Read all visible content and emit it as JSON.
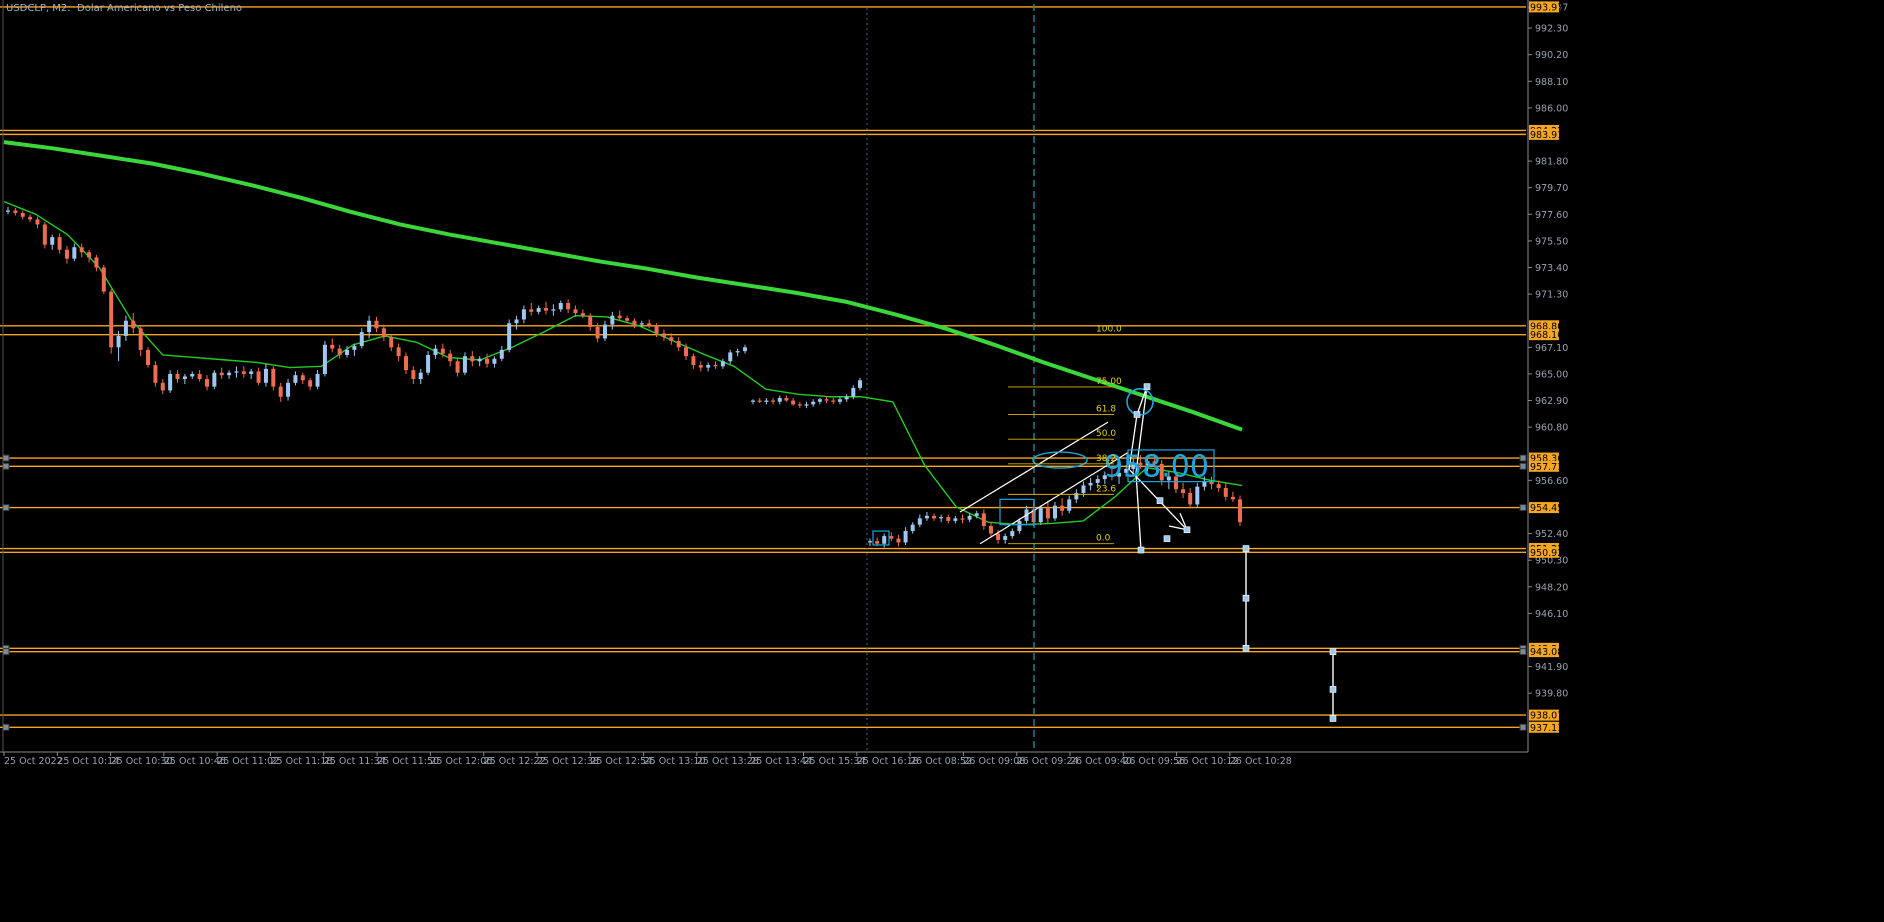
{
  "header": {
    "symbol_text": "USDCLP, M2:  Dolar Americano vs Peso Chileno"
  },
  "colors": {
    "background": "#000000",
    "bull_candle": "#9ec8f0",
    "bear_candle": "#f06c50",
    "level_line": "#f5a623",
    "ma_fast": "#22cc22",
    "ma_slow": "#3ad63a",
    "drawing": "#ffffff",
    "cyan_object": "#1aa6e0",
    "fib_text": "#e6d21a",
    "axis_text": "#9aa0b0",
    "separator": "#2a4a5a"
  },
  "chart_data": {
    "type": "candlestick",
    "symbol": "USDCLP",
    "timeframe": "M2",
    "ylim": [
      936.5,
      994.2
    ],
    "y_ticks": [
      "993.97",
      "992.30",
      "990.20",
      "988.10",
      "986.00",
      "981.80",
      "979.70",
      "977.60",
      "975.50",
      "973.40",
      "971.30",
      "967.10",
      "965.00",
      "962.90",
      "960.80",
      "956.60",
      "952.40",
      "950.30",
      "948.20",
      "946.10",
      "941.90",
      "939.80"
    ],
    "x_ticks": [
      "25 Oct 2022",
      "25 Oct 10:14",
      "25 Oct 10:30",
      "25 Oct 10:46",
      "25 Oct 11:02",
      "25 Oct 11:18",
      "25 Oct 11:34",
      "25 Oct 11:50",
      "25 Oct 12:06",
      "25 Oct 12:22",
      "25 Oct 12:38",
      "25 Oct 12:54",
      "25 Oct 13:10",
      "25 Oct 13:28",
      "25 Oct 13:44",
      "25 Oct 15:34",
      "25 Oct 16:18",
      "26 Oct 08:52",
      "26 Oct 09:08",
      "26 Oct 09:24",
      "26 Oct 09:40",
      "26 Oct 09:56",
      "26 Oct 10:12",
      "26 Oct 10:28"
    ],
    "horizontal_levels": [
      {
        "price": 993.97,
        "label": "993.97"
      },
      {
        "price": 984.22,
        "label": "984.22"
      },
      {
        "price": 983.91,
        "label": "983.91"
      },
      {
        "price": 968.8,
        "label": "968.80"
      },
      {
        "price": 968.1,
        "label": "968.10"
      },
      {
        "price": 958.36,
        "label": "958.36"
      },
      {
        "price": 957.71,
        "label": "957.71"
      },
      {
        "price": 954.45,
        "label": "954.45"
      },
      {
        "price": 951.22,
        "label": "951.22"
      },
      {
        "price": 950.92,
        "label": "950.92"
      },
      {
        "price": 943.34,
        "label": "943.34"
      },
      {
        "price": 943.08,
        "label": "943.08"
      },
      {
        "price": 938.07,
        "label": "938.07"
      },
      {
        "price": 937.11,
        "label": "937.11"
      }
    ],
    "fibonacci": {
      "levels": [
        "100.0",
        "75.00",
        "61.8",
        "50.0",
        "38.2",
        "23.6",
        "0.0"
      ],
      "price_high": 968.1,
      "price_low": 951.6
    },
    "big_price_text": "958.00",
    "ma_slow": [
      983.3,
      982.8,
      982.2,
      981.6,
      980.8,
      979.9,
      978.9,
      977.8,
      976.8,
      976.0,
      975.3,
      974.6,
      973.9,
      973.3,
      972.6,
      972.0,
      971.4,
      970.7,
      969.7,
      968.6,
      967.3,
      965.9,
      964.6,
      963.3,
      962.0,
      960.6
    ],
    "ma_fast": [
      978.6,
      977.6,
      976.0,
      973.4,
      969.3,
      966.5,
      966.3,
      966.1,
      965.9,
      965.5,
      965.6,
      967.3,
      968.0,
      967.5,
      966.3,
      966.1,
      967.1,
      968.3,
      969.6,
      969.5,
      968.8,
      967.7,
      966.6,
      965.6,
      963.8,
      963.4,
      963.2,
      963.2,
      962.8,
      957.8,
      954.5,
      953.3,
      953.1,
      953.2,
      953.4,
      955.3,
      957.6,
      957.2,
      956.6,
      956.2
    ],
    "candles": [
      [
        977.8,
        978.2,
        977.6,
        977.9
      ],
      [
        977.9,
        978.1,
        977.5,
        977.7
      ],
      [
        977.7,
        977.9,
        977.2,
        977.4
      ],
      [
        977.4,
        977.6,
        977.0,
        977.2
      ],
      [
        977.2,
        977.4,
        976.5,
        976.8
      ],
      [
        976.8,
        977.0,
        974.9,
        975.2
      ],
      [
        975.2,
        976.0,
        974.8,
        975.8
      ],
      [
        975.8,
        976.1,
        974.5,
        974.8
      ],
      [
        974.8,
        975.1,
        973.7,
        974.1
      ],
      [
        974.1,
        975.3,
        973.9,
        975.0
      ],
      [
        975.0,
        975.3,
        974.2,
        974.6
      ],
      [
        974.6,
        974.8,
        973.8,
        974.2
      ],
      [
        974.2,
        974.4,
        973.1,
        973.4
      ],
      [
        973.4,
        973.6,
        971.3,
        971.5
      ],
      [
        971.5,
        971.7,
        966.6,
        967.1
      ],
      [
        967.1,
        968.4,
        966.0,
        968.0
      ],
      [
        968.0,
        969.6,
        967.6,
        969.2
      ],
      [
        969.2,
        969.8,
        968.2,
        968.6
      ],
      [
        968.6,
        968.8,
        966.4,
        966.9
      ],
      [
        966.9,
        967.1,
        965.5,
        965.7
      ],
      [
        965.7,
        966.0,
        964.0,
        964.3
      ],
      [
        964.3,
        964.6,
        963.4,
        963.7
      ],
      [
        963.7,
        965.3,
        963.5,
        965.0
      ],
      [
        965.0,
        965.3,
        964.3,
        964.6
      ],
      [
        964.6,
        965.0,
        964.2,
        964.8
      ],
      [
        964.8,
        965.2,
        964.6,
        965.0
      ],
      [
        965.0,
        965.3,
        964.4,
        964.6
      ],
      [
        964.6,
        964.9,
        963.7,
        964.0
      ],
      [
        964.0,
        965.3,
        963.8,
        965.1
      ],
      [
        965.1,
        965.5,
        964.6,
        964.9
      ],
      [
        964.9,
        965.3,
        964.6,
        965.1
      ],
      [
        965.1,
        965.6,
        964.7,
        965.2
      ],
      [
        965.2,
        965.6,
        964.7,
        965.0
      ],
      [
        965.0,
        965.4,
        964.6,
        965.2
      ],
      [
        965.2,
        965.5,
        964.1,
        964.3
      ],
      [
        964.3,
        965.8,
        964.0,
        965.4
      ],
      [
        965.4,
        965.6,
        963.7,
        964.0
      ],
      [
        964.0,
        964.3,
        962.8,
        963.2
      ],
      [
        963.2,
        964.6,
        962.9,
        964.3
      ],
      [
        964.3,
        965.2,
        964.1,
        964.9
      ],
      [
        964.9,
        965.1,
        964.2,
        964.5
      ],
      [
        964.5,
        964.7,
        963.7,
        964.0
      ],
      [
        964.0,
        965.3,
        963.8,
        965.0
      ],
      [
        965.0,
        967.6,
        964.8,
        967.3
      ],
      [
        967.3,
        967.8,
        966.7,
        967.0
      ],
      [
        967.0,
        967.3,
        966.2,
        966.5
      ],
      [
        966.5,
        967.2,
        966.3,
        966.9
      ],
      [
        966.9,
        967.4,
        966.4,
        967.2
      ],
      [
        967.2,
        968.6,
        967.0,
        968.3
      ],
      [
        968.3,
        969.6,
        967.8,
        969.2
      ],
      [
        969.2,
        969.5,
        968.3,
        968.6
      ],
      [
        968.6,
        968.9,
        967.6,
        967.9
      ],
      [
        967.9,
        968.1,
        966.8,
        967.1
      ],
      [
        967.1,
        967.4,
        966.0,
        966.4
      ],
      [
        966.4,
        966.7,
        965.0,
        965.3
      ],
      [
        965.3,
        965.6,
        964.2,
        964.6
      ],
      [
        964.6,
        965.4,
        964.2,
        965.1
      ],
      [
        965.1,
        966.8,
        964.9,
        966.5
      ],
      [
        966.5,
        967.3,
        966.2,
        967.0
      ],
      [
        967.0,
        967.4,
        966.3,
        966.6
      ],
      [
        966.6,
        966.9,
        965.6,
        966.0
      ],
      [
        966.0,
        966.3,
        964.8,
        965.1
      ],
      [
        965.1,
        966.7,
        964.9,
        966.4
      ],
      [
        966.4,
        966.8,
        965.6,
        966.0
      ],
      [
        966.0,
        966.4,
        965.6,
        966.2
      ],
      [
        966.2,
        966.6,
        965.5,
        965.8
      ],
      [
        965.8,
        966.4,
        965.5,
        966.2
      ],
      [
        966.2,
        967.2,
        966.0,
        966.9
      ],
      [
        966.9,
        969.3,
        966.7,
        969.0
      ],
      [
        969.0,
        969.6,
        968.5,
        969.3
      ],
      [
        969.3,
        970.4,
        969.0,
        970.1
      ],
      [
        970.1,
        970.6,
        969.6,
        969.9
      ],
      [
        969.9,
        970.4,
        969.7,
        970.2
      ],
      [
        970.2,
        970.7,
        969.7,
        970.0
      ],
      [
        970.0,
        970.5,
        969.6,
        970.1
      ],
      [
        970.1,
        970.8,
        969.9,
        970.6
      ],
      [
        970.6,
        970.9,
        969.8,
        970.1
      ],
      [
        970.1,
        970.4,
        969.5,
        969.8
      ],
      [
        969.8,
        970.1,
        969.4,
        969.6
      ],
      [
        969.6,
        969.8,
        968.4,
        968.7
      ],
      [
        968.7,
        969.0,
        967.5,
        967.8
      ],
      [
        967.8,
        969.2,
        967.6,
        968.9
      ],
      [
        968.9,
        969.9,
        968.5,
        969.6
      ],
      [
        969.6,
        970.0,
        969.2,
        969.4
      ],
      [
        969.4,
        969.6,
        969.0,
        969.2
      ],
      [
        969.2,
        969.4,
        968.6,
        968.9
      ],
      [
        968.9,
        969.2,
        968.7,
        969.0
      ],
      [
        969.0,
        969.3,
        968.6,
        968.8
      ],
      [
        968.8,
        969.0,
        967.9,
        968.2
      ],
      [
        968.2,
        968.5,
        967.6,
        967.9
      ],
      [
        967.9,
        968.2,
        967.3,
        967.6
      ],
      [
        967.6,
        967.9,
        966.8,
        967.1
      ],
      [
        967.1,
        967.4,
        966.1,
        966.4
      ],
      [
        966.4,
        966.6,
        965.4,
        965.7
      ],
      [
        965.7,
        966.0,
        965.2,
        965.5
      ],
      [
        965.5,
        965.9,
        965.2,
        965.7
      ],
      [
        965.7,
        966.0,
        965.4,
        965.6
      ],
      [
        965.6,
        966.2,
        965.4,
        966.0
      ],
      [
        966.0,
        966.9,
        965.8,
        966.7
      ],
      [
        966.7,
        967.0,
        966.4,
        966.8
      ],
      [
        966.8,
        967.3,
        966.6,
        967.1
      ],
      [
        962.8,
        963.0,
        962.6,
        962.9
      ],
      [
        962.9,
        963.1,
        962.7,
        962.8
      ],
      [
        962.8,
        963.1,
        962.6,
        962.9
      ],
      [
        962.9,
        963.1,
        962.6,
        962.8
      ],
      [
        962.8,
        963.3,
        962.6,
        963.1
      ],
      [
        963.1,
        963.3,
        962.8,
        962.9
      ],
      [
        962.9,
        963.1,
        962.5,
        962.6
      ],
      [
        962.6,
        962.8,
        962.3,
        962.5
      ],
      [
        962.5,
        962.8,
        962.3,
        962.6
      ],
      [
        962.6,
        963.0,
        962.4,
        962.8
      ],
      [
        962.8,
        963.1,
        962.6,
        963.0
      ],
      [
        963.0,
        963.2,
        962.7,
        962.9
      ],
      [
        962.9,
        963.1,
        962.6,
        962.8
      ],
      [
        962.8,
        963.2,
        962.6,
        963.0
      ],
      [
        963.0,
        963.4,
        962.8,
        963.2
      ],
      [
        963.2,
        964.1,
        963.0,
        963.9
      ],
      [
        963.9,
        964.7,
        963.7,
        964.5
      ],
      [
        951.7,
        952.0,
        951.4,
        951.8
      ],
      [
        951.8,
        952.1,
        951.4,
        951.6
      ],
      [
        951.6,
        952.4,
        951.3,
        952.2
      ],
      [
        952.2,
        952.5,
        951.8,
        952.0
      ],
      [
        952.0,
        952.3,
        951.4,
        951.7
      ],
      [
        951.7,
        952.9,
        951.5,
        952.6
      ],
      [
        952.6,
        953.3,
        952.4,
        953.1
      ],
      [
        953.1,
        953.9,
        952.9,
        953.6
      ],
      [
        953.6,
        954.1,
        953.4,
        953.8
      ],
      [
        953.8,
        954.0,
        953.4,
        953.6
      ],
      [
        953.6,
        953.9,
        953.3,
        953.7
      ],
      [
        953.7,
        953.9,
        953.2,
        953.4
      ],
      [
        953.4,
        953.8,
        953.2,
        953.6
      ],
      [
        953.6,
        953.9,
        953.2,
        953.5
      ],
      [
        953.5,
        954.0,
        953.3,
        953.8
      ],
      [
        953.8,
        954.2,
        953.6,
        954.0
      ],
      [
        954.0,
        954.3,
        952.7,
        953.0
      ],
      [
        953.0,
        953.3,
        952.1,
        952.4
      ],
      [
        952.4,
        952.7,
        951.6,
        951.9
      ],
      [
        951.9,
        952.4,
        951.6,
        952.2
      ],
      [
        952.2,
        952.8,
        952.0,
        952.6
      ],
      [
        952.6,
        953.6,
        952.4,
        953.4
      ],
      [
        953.4,
        954.6,
        953.2,
        954.3
      ],
      [
        954.3,
        954.9,
        953.0,
        953.3
      ],
      [
        953.3,
        954.6,
        953.1,
        954.4
      ],
      [
        954.4,
        955.0,
        953.2,
        953.6
      ],
      [
        953.6,
        954.9,
        953.4,
        954.6
      ],
      [
        954.6,
        955.2,
        953.8,
        954.2
      ],
      [
        954.2,
        955.4,
        954.0,
        955.1
      ],
      [
        955.1,
        955.9,
        954.8,
        955.6
      ],
      [
        955.6,
        956.5,
        955.3,
        956.2
      ],
      [
        956.2,
        956.8,
        955.8,
        956.4
      ],
      [
        956.4,
        957.0,
        956.0,
        956.7
      ],
      [
        956.7,
        957.3,
        956.3,
        957.0
      ],
      [
        957.0,
        957.6,
        956.6,
        956.9
      ],
      [
        956.9,
        957.4,
        956.3,
        957.2
      ],
      [
        957.2,
        957.8,
        956.9,
        957.5
      ],
      [
        957.5,
        958.3,
        957.2,
        958.0
      ],
      [
        958.0,
        958.6,
        957.5,
        957.8
      ],
      [
        957.8,
        958.3,
        957.3,
        958.1
      ],
      [
        958.1,
        958.7,
        957.6,
        957.9
      ],
      [
        957.9,
        958.2,
        956.2,
        956.6
      ],
      [
        956.6,
        957.3,
        955.9,
        956.9
      ],
      [
        956.9,
        957.2,
        955.6,
        955.9
      ],
      [
        955.9,
        956.4,
        955.2,
        955.6
      ],
      [
        955.6,
        956.0,
        954.4,
        954.7
      ],
      [
        954.7,
        956.4,
        954.5,
        956.1
      ],
      [
        956.1,
        956.9,
        955.8,
        956.5
      ],
      [
        956.5,
        956.9,
        955.9,
        956.3
      ],
      [
        956.3,
        956.6,
        955.7,
        956.0
      ],
      [
        956.0,
        956.4,
        955.0,
        955.3
      ],
      [
        955.3,
        955.7,
        954.9,
        955.1
      ],
      [
        955.1,
        955.4,
        953.0,
        953.3
      ]
    ],
    "projection_points": [
      {
        "price": 951.22
      },
      {
        "price": 947.3
      },
      {
        "price": 943.34
      },
      {
        "price": 943.08
      },
      {
        "price": 940.1
      },
      {
        "price": 937.8
      }
    ]
  }
}
